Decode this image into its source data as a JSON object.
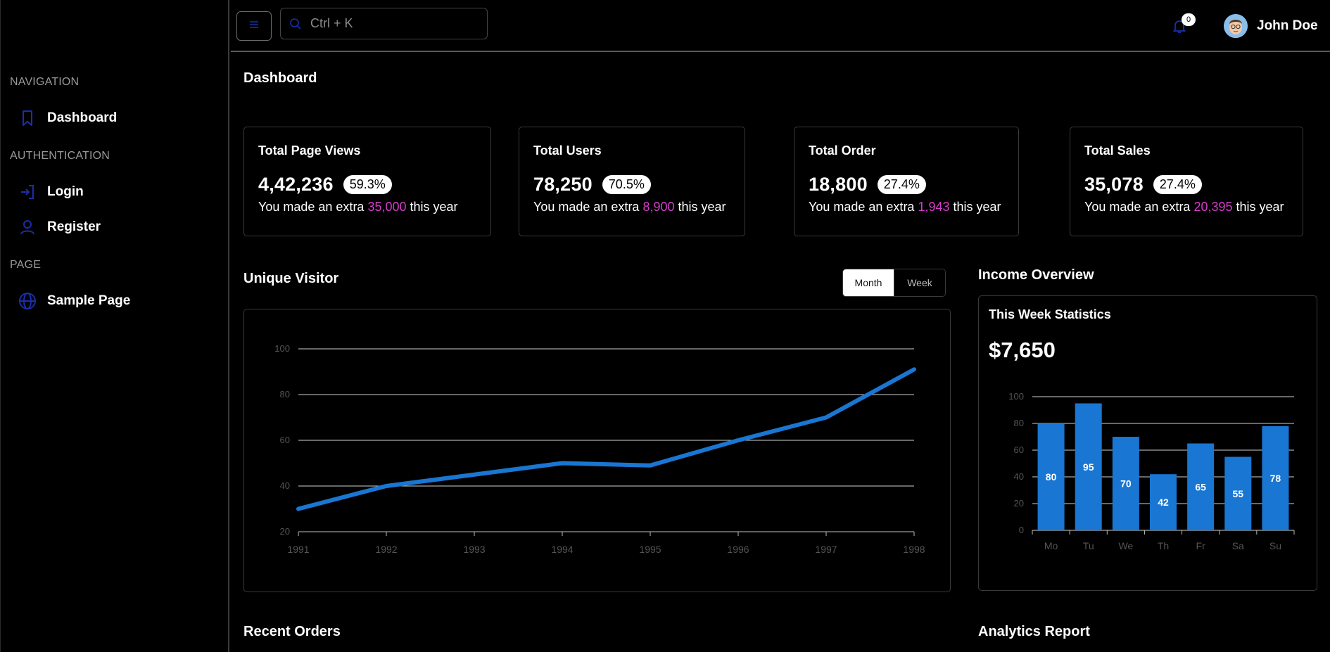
{
  "sidebar": {
    "sections": [
      {
        "label": "NAVIGATION",
        "items": [
          {
            "label": "Dashboard",
            "icon": "bookmark-icon"
          }
        ]
      },
      {
        "label": "AUTHENTICATION",
        "items": [
          {
            "label": "Login",
            "icon": "login-icon"
          },
          {
            "label": "Register",
            "icon": "user-icon"
          }
        ]
      },
      {
        "label": "PAGE",
        "items": [
          {
            "label": "Sample Page",
            "icon": "globe-icon"
          }
        ]
      }
    ]
  },
  "header": {
    "search_placeholder": "Ctrl + K",
    "notification_count": "0",
    "user_name": "John Doe"
  },
  "main": {
    "title": "Dashboard",
    "cards": [
      {
        "title": "Total Page Views",
        "value": "4,42,236",
        "badge": "59.3%",
        "foot_pre": "You made an extra ",
        "foot_hl": "35,000",
        "foot_post": " this year"
      },
      {
        "title": "Total Users",
        "value": "78,250",
        "badge": "70.5%",
        "foot_pre": "You made an extra ",
        "foot_hl": "8,900",
        "foot_post": " this year"
      },
      {
        "title": "Total Order",
        "value": "18,800",
        "badge": "27.4%",
        "foot_pre": "You made an extra ",
        "foot_hl": "1,943",
        "foot_post": " this year"
      },
      {
        "title": "Total Sales",
        "value": "35,078",
        "badge": "27.4%",
        "foot_pre": "You made an extra ",
        "foot_hl": "20,395",
        "foot_post": " this year"
      }
    ],
    "unique_visitor": {
      "title": "Unique Visitor",
      "toggle": [
        "Month",
        "Week"
      ],
      "active": "Month"
    },
    "income": {
      "title": "Income Overview",
      "subtitle": "This Week Statistics",
      "amount": "$7,650"
    },
    "recent_orders_title": "Recent Orders",
    "analytics_title": "Analytics Report"
  },
  "colors": {
    "accent": "#1976d2",
    "highlight": "#d63bcb",
    "icon_blue": "#1a2fa8"
  },
  "chart_data": [
    {
      "type": "line",
      "x": [
        1991,
        1992,
        1993,
        1994,
        1995,
        1996,
        1997,
        1998
      ],
      "series": [
        {
          "values": [
            30,
            40,
            45,
            50,
            49,
            60,
            70,
            91
          ]
        }
      ],
      "ylim": [
        20,
        100
      ],
      "yticks": [
        20,
        40,
        60,
        80,
        100
      ],
      "grid": true
    },
    {
      "type": "bar",
      "categories": [
        "Mo",
        "Tu",
        "We",
        "Th",
        "Fr",
        "Sa",
        "Su"
      ],
      "values": [
        80,
        95,
        70,
        42,
        65,
        55,
        78
      ],
      "ylim": [
        0,
        100
      ],
      "yticks": [
        0,
        20,
        40,
        60,
        80,
        100
      ],
      "grid": true
    }
  ]
}
